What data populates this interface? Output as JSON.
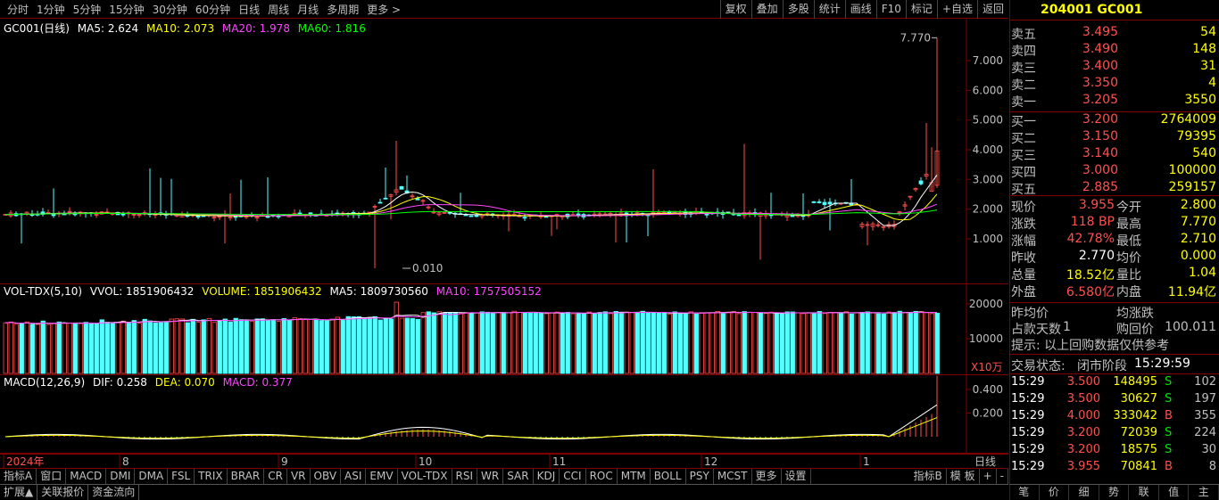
{
  "toolbar": {
    "left": [
      "分时",
      "1分钟",
      "5分钟",
      "15分钟",
      "30分钟",
      "60分钟",
      "日线",
      "周线",
      "月线",
      "多周期",
      "更多 >"
    ],
    "right": [
      "复权",
      "叠加",
      "多股",
      "统计",
      "画线",
      "F10",
      "标记",
      "+自选",
      "返回"
    ]
  },
  "price_legend": {
    "name": "GC001(日线)",
    "ma5": "MA5: 2.624",
    "ma10": "MA10: 2.073",
    "ma20": "MA20: 1.978",
    "ma60": "MA60: 1.816"
  },
  "price_axis": [
    "7.000",
    "6.000",
    "5.000",
    "4.000",
    "3.000",
    "2.000",
    "1.000"
  ],
  "max_label": "7.770",
  "min_label": "0.010",
  "vol_legend": {
    "name": "VOL-TDX(5,10)",
    "vvol": "VVOL: 1851906432",
    "volume": "VOLUME: 1851906432",
    "ma5": "MA5: 1809730560",
    "ma10": "MA10: 1757505152"
  },
  "vol_axis": [
    "20000",
    "10000"
  ],
  "vol_unit": "X10万",
  "macd_legend": {
    "name": "MACD(12,26,9)",
    "dif": "DIF: 0.258",
    "dea": "DEA: 0.070",
    "macd": "MACD: 0.377"
  },
  "macd_axis": [
    "0.400",
    "0.200"
  ],
  "time_axis": {
    "labels": [
      "2024年",
      "8",
      "9",
      "10",
      "11",
      "12",
      "1"
    ],
    "period": "日线"
  },
  "indicator_tabs": [
    "指标A",
    "窗口",
    "MACD",
    "DMI",
    "DMA",
    "FSL",
    "TRIX",
    "BRAR",
    "CR",
    "VR",
    "OBV",
    "ASI",
    "EMV",
    "VOL-TDX",
    "RSI",
    "WR",
    "SAR",
    "KDJ",
    "CCI",
    "ROC",
    "MTM",
    "BOLL",
    "PSY",
    "MCST",
    "更多",
    "设置"
  ],
  "indicator_right": [
    "指标B",
    "模 板",
    "+",
    "-"
  ],
  "bottom_tabs": [
    "扩展▲",
    "关联报价",
    "资金流向"
  ],
  "quote": {
    "title": "204001 GC001",
    "asks": [
      {
        "l": "卖五",
        "p": "3.495",
        "v": "54"
      },
      {
        "l": "卖四",
        "p": "3.490",
        "v": "148"
      },
      {
        "l": "卖三",
        "p": "3.400",
        "v": "31"
      },
      {
        "l": "卖二",
        "p": "3.350",
        "v": "4"
      },
      {
        "l": "卖一",
        "p": "3.205",
        "v": "3550"
      }
    ],
    "bids": [
      {
        "l": "买一",
        "p": "3.200",
        "v": "2764009"
      },
      {
        "l": "买二",
        "p": "3.150",
        "v": "79395"
      },
      {
        "l": "买三",
        "p": "3.140",
        "v": "540"
      },
      {
        "l": "买四",
        "p": "3.000",
        "v": "100000"
      },
      {
        "l": "买五",
        "p": "2.885",
        "v": "259157"
      }
    ],
    "stats": [
      {
        "l1": "现价",
        "v1": "3.955",
        "l2": "今开",
        "v2": "2.800"
      },
      {
        "l1": "涨跌",
        "v1": "118 BP",
        "l2": "最高",
        "v2": "7.770"
      },
      {
        "l1": "涨幅",
        "v1": "42.78%",
        "l2": "最低",
        "v2": "2.710"
      },
      {
        "l1": "昨收",
        "v1": "2.770",
        "l2": "均价",
        "v2": "0.000"
      },
      {
        "l1": "总量",
        "v1": "18.52亿",
        "l2": "量比",
        "v2": "1.04"
      },
      {
        "l1": "外盘",
        "v1": "6.580亿",
        "l2": "内盘",
        "v2": "11.94亿"
      }
    ],
    "extra": {
      "prev_avg": "昨均价",
      "avg_change": "均涨跌",
      "days_label": "占款天数",
      "days": "1",
      "repurchase_label": "购回价",
      "repurchase": "100.011",
      "hint": "提示: 以上回购数据仅供参考",
      "status_label": "交易状态:",
      "status": "闭市阶段",
      "time": "15:29:59"
    },
    "ticks": [
      {
        "t": "15:29",
        "p": "3.500",
        "v": "148495",
        "s": "S",
        "n": "102"
      },
      {
        "t": "15:29",
        "p": "3.500",
        "v": "30627",
        "s": "S",
        "n": "197"
      },
      {
        "t": "15:29",
        "p": "4.000",
        "v": "333042",
        "s": "B",
        "n": "355"
      },
      {
        "t": "15:29",
        "p": "3.200",
        "v": "72039",
        "s": "S",
        "n": "224"
      },
      {
        "t": "15:29",
        "p": "3.200",
        "v": "18575",
        "s": "S",
        "n": "30"
      },
      {
        "t": "15:29",
        "p": "3.955",
        "v": "70841",
        "s": "B",
        "n": "8"
      }
    ],
    "side_tabs": [
      "笔",
      "价",
      "细",
      "势",
      "联",
      "值",
      "主"
    ]
  },
  "colors": {
    "up": "#ff5050",
    "down": "#54ffff",
    "ma5": "#ffffff",
    "ma10": "#ffff00",
    "ma20": "#ff44ff",
    "ma60": "#00ff00",
    "grid": "#800000"
  }
}
